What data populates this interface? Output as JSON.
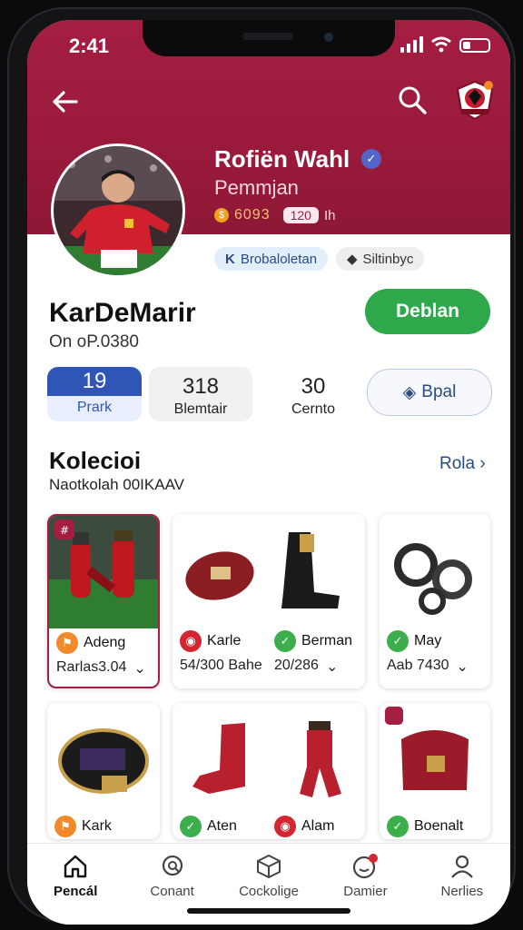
{
  "status": {
    "time": "2:41"
  },
  "profile": {
    "name": "Rofiën Wahl",
    "role": "Pemmjan",
    "coins": "6093",
    "level_badge": "120",
    "level_suffix": "Ih",
    "tags": [
      {
        "label": "Brobaloletan",
        "icon": "kick-icon"
      },
      {
        "label": "Siltinbyc",
        "icon": "diamond-icon"
      }
    ]
  },
  "owner": {
    "display_name": "KarDeMarir",
    "id_text": "On oP.0380",
    "follow_label": "Deblan"
  },
  "stats": [
    {
      "value": "19",
      "label": "Prark"
    },
    {
      "value": "318",
      "label": "Blemtair"
    },
    {
      "value": "30",
      "label": "Cernto"
    }
  ],
  "deal_label": "Bpal",
  "collection": {
    "title": "Kolecioi",
    "subtitle": "Naotkolah 00IKAAV",
    "see_all": "Rola"
  },
  "items": [
    {
      "name": "Adeng",
      "price": "Rarlas3.04",
      "icon_color": "#f28a2a",
      "badge": "#"
    },
    {
      "name": "Karle",
      "price": "54/300 Bahe",
      "icon_color": "#d32630"
    },
    {
      "name": "Berman",
      "price": "20/286",
      "icon_color": "#3cae4c"
    },
    {
      "name": "May",
      "price": "Aab 7430",
      "icon_color": "#3cae4c"
    },
    {
      "name": "Kark",
      "price": "",
      "icon_color": "#f28a2a"
    },
    {
      "name": "Aten",
      "price": "",
      "icon_color": "#3cae4c"
    },
    {
      "name": "Alam",
      "price": "",
      "icon_color": "#d32630"
    },
    {
      "name": "Boenalt",
      "price": "",
      "icon_color": "#3cae4c"
    }
  ],
  "tabs": [
    {
      "label": "Pencál",
      "icon": "home-icon"
    },
    {
      "label": "Conant",
      "icon": "search-chat-icon"
    },
    {
      "label": "Cockolige",
      "icon": "box-icon"
    },
    {
      "label": "Damier",
      "icon": "notification-icon"
    },
    {
      "label": "Nerlies",
      "icon": "person-icon"
    }
  ],
  "colors": {
    "brand": "#a41e42",
    "follow": "#2ea84a",
    "link": "#2a4b86"
  }
}
